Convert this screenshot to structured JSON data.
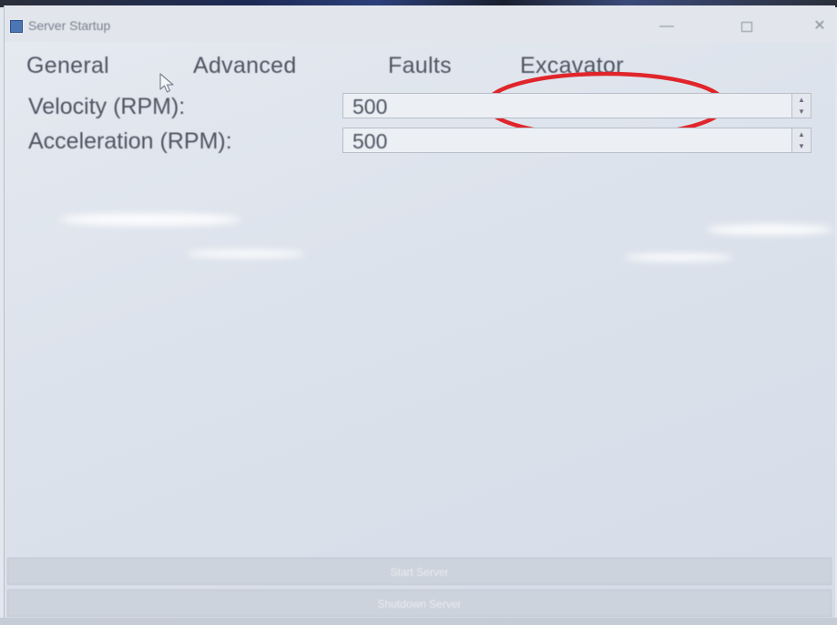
{
  "window": {
    "title": "Server Startup",
    "minimize_glyph": "—",
    "close_glyph": "✕"
  },
  "tabs": [
    {
      "label": "General"
    },
    {
      "label": "Advanced"
    },
    {
      "label": "Faults"
    },
    {
      "label": "Excavator"
    }
  ],
  "fields": {
    "velocity": {
      "label": "Velocity (RPM):",
      "value": "500"
    },
    "acceleration": {
      "label": "Acceleration (RPM):",
      "value": "500"
    }
  },
  "spin_glyphs": {
    "up": "▲",
    "down": "▼"
  },
  "buttons": {
    "start": "Start Server",
    "shutdown": "Shutdown Server"
  },
  "annotation": {
    "color": "#e0262b",
    "target": "Excavator"
  },
  "icons": {
    "app": "app-window-icon",
    "cursor": "mouse-pointer-icon"
  }
}
